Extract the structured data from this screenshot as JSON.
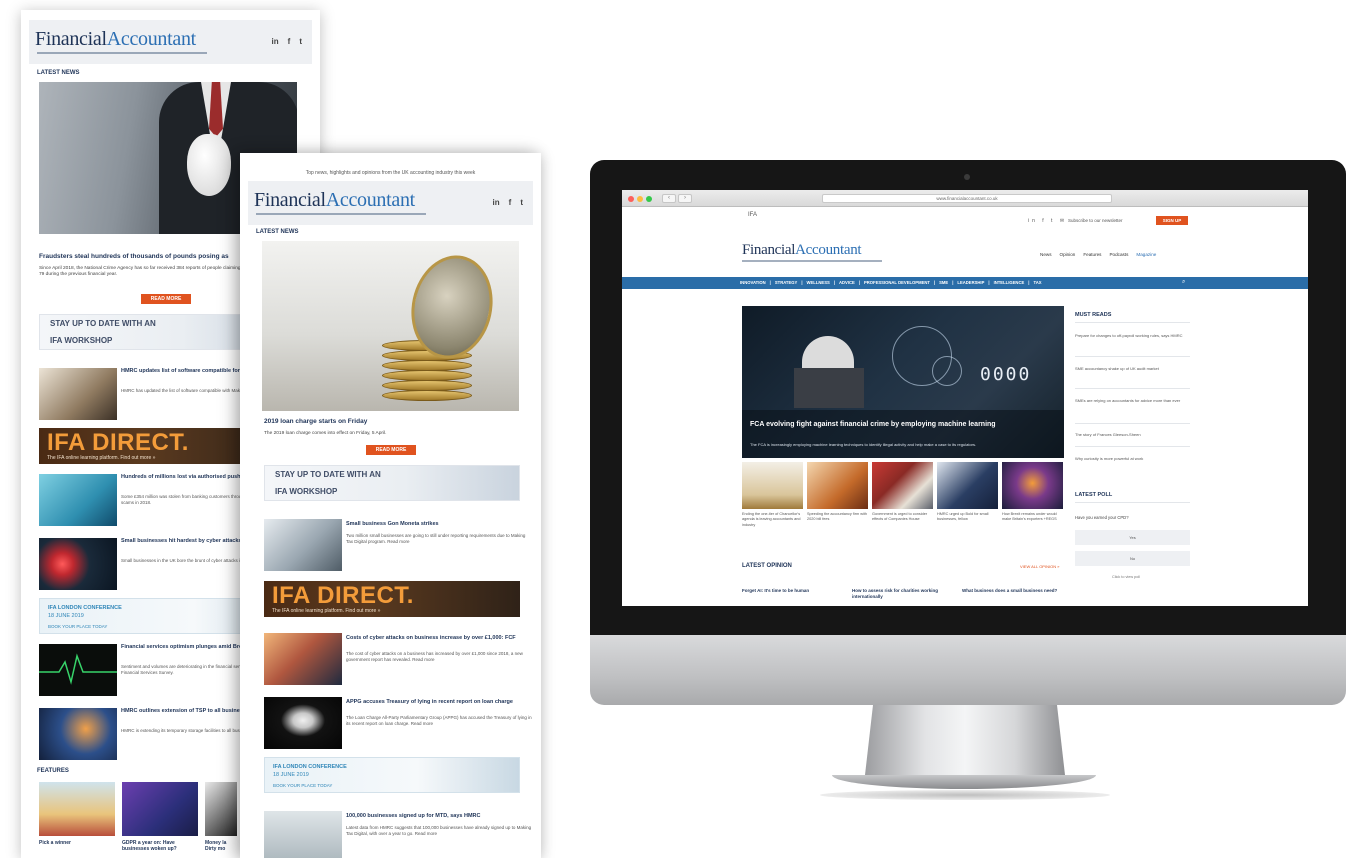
{
  "brand": {
    "name_part1": "Financial",
    "name_part2": "Accountant",
    "accent_orange": "#e0531f",
    "navy": "#1e3357",
    "blue": "#2c6fb3"
  },
  "newsletter1": {
    "social": [
      "in",
      "f",
      "t"
    ],
    "section_latest": "LATEST NEWS",
    "hero_title": "Fraudsters steal hundreds of thousands of pounds posing as",
    "hero_text": "Since April 2018, the National Crime Agency has so far received 384 reports of people claiming to be NCA officers, up from 79 during the previous financial year.",
    "read_more": "READ MORE",
    "workshop_line1": "STAY UP TO DATE WITH AN",
    "workshop_line2": "IFA WORKSHOP",
    "teaser1_title": "HMRC updates list of software compatible for VAT",
    "teaser1_text": "HMRC has updated the list of software compatible with Making Tax Digital for VAT.",
    "ifa_direct": "IFA DIRECT.",
    "ifa_tagline": "The IFA online learning platform. Find out more »",
    "teaser2_title": "Hundreds of millions lost via authorised push payment fraud in 2018",
    "teaser2_text": "Some £354 million was stolen from banking customers through authorised push payment scams in 2018.",
    "teaser3_title": "Small businesses hit hardest by cyber attacks in 2018",
    "teaser3_text": "Small businesses in the UK bore the brunt of cyber attacks in 2018, according to a new report.",
    "conf_line1": "IFA LONDON CONFERENCE",
    "conf_line2": "18 JUNE 2019",
    "conf_line3": "BOOK YOUR PLACE TODAY",
    "teaser4_title": "Financial services optimism plunges amid Brexit crisis",
    "teaser4_text": "Sentiment and volumes are deteriorating in the financial services sector, according to the latest Financial Services Survey.",
    "teaser5_title": "HMRC outlines extension of TSP to all businesses",
    "teaser5_text": "HMRC is extending its temporary storage facilities to all businesses importing goods.",
    "section_features": "FEATURES",
    "feature1": "Pick a winner",
    "feature2": "GDPR a year on: Have businesses woken up?",
    "feature3": "Money la Dirty mo"
  },
  "newsletter2": {
    "preheader": "Top news, highlights and opinions from the UK accounting industry this week",
    "social": [
      "in",
      "f",
      "t"
    ],
    "section_latest": "LATEST NEWS",
    "hero_title": "2019 loan charge starts on Friday",
    "hero_text": "The 2019 loan charge comes into effect on Friday, 5 April.",
    "read_more": "READ MORE",
    "workshop_line1": "STAY UP TO DATE WITH AN",
    "workshop_line2": "IFA WORKSHOP",
    "teaser1_title": "Small business Gon Moneta strikes",
    "teaser1_text": "Two million small businesses are going to still under reporting requirements due to Making Tax Digital program. Read more",
    "ifa_direct": "IFA DIRECT.",
    "ifa_tagline": "The IFA online learning platform. Find out more »",
    "teaser2_title": "Costs of cyber attacks on business increase by over £1,000: FCF",
    "teaser2_text": "The cost of cyber attacks on a business has increased by over £1,000 since 2018, a new government report has revealed. Read more",
    "teaser3_title": "APPG accuses Treasury of lying in recent report on loan charge",
    "teaser3_text": "The Loan Charge All-Party Parliamentary Group (APPG) has accused the Treasury of lying in its recent report on loan charge. Read more",
    "conf_line1": "IFA LONDON CONFERENCE",
    "conf_line2": "18 JUNE 2019",
    "conf_line3": "BOOK YOUR PLACE TODAY",
    "teaser4_title": "100,000 businesses signed up for MTD, says HMRC",
    "teaser4_text": "Latest data from HMRC suggests that 100,000 businesses have already signed up to Making Tax Digital, with over a year to go. Read more"
  },
  "browser": {
    "url": "www.financialaccountant.co.uk",
    "back": "‹",
    "forward": "›"
  },
  "site": {
    "ifa_mark": "IFA",
    "social": "in f t ✉",
    "subscribe_text": "Subscribe to our newsletter",
    "signup_label": "SIGN UP",
    "nav": [
      "News",
      "Opinion",
      "Features",
      "Podcasts",
      "Magazine"
    ],
    "categories": [
      "INNOVATION",
      "|",
      "STRATEGY",
      "|",
      "WELLNESS",
      "|",
      "ADVICE",
      "|",
      "PROFESSIONAL DEVELOPMENT",
      "|",
      "SME",
      "|",
      "LEADERSHIP",
      "|",
      "INTELLIGENCE",
      "|",
      "TAX"
    ],
    "search_icon_glyph": "⌕",
    "hero_headline": "FCA evolving fight against financial crime by employing machine learning",
    "hero_sub": "The FCA is increasingly employing machine learning techniques to identify illegal activity and help make a case to its regulators.",
    "hero_digits": "0000",
    "thumbs": [
      "Ending the one-tier of Chancellor's agenda is leaving accountants and industry",
      "Speeding the accountancy firm with 2020 bill fees",
      "Government is urged to consider effects of Companies House",
      "HMRC urged up Bold for small businesses, fellow",
      "How Brexit remains under would make Britain's exporters +REGS"
    ],
    "latest_opinion": "LATEST OPINION",
    "view_all": "VIEW ALL OPINION »",
    "opinions": [
      "Forget AI: It's time to be human",
      "How to assess risk for charities working internationally",
      "What business does a small business need?"
    ],
    "must_reads_title": "MUST READS",
    "must_reads": [
      "Prepare for changes to off-payroll working rules, says HMRC",
      "SME accountancy shake up of UK audit market",
      "SMEs are relying on accountants for advice more than ever",
      "The story of Frances Gleeson-Sheen",
      "Why curiosity is more powerful at work"
    ],
    "poll_title": "LATEST POLL",
    "poll_question": "Have you earned your CPD?",
    "poll_options": [
      "Yes",
      "No"
    ],
    "poll_link": "Click to view poll"
  }
}
